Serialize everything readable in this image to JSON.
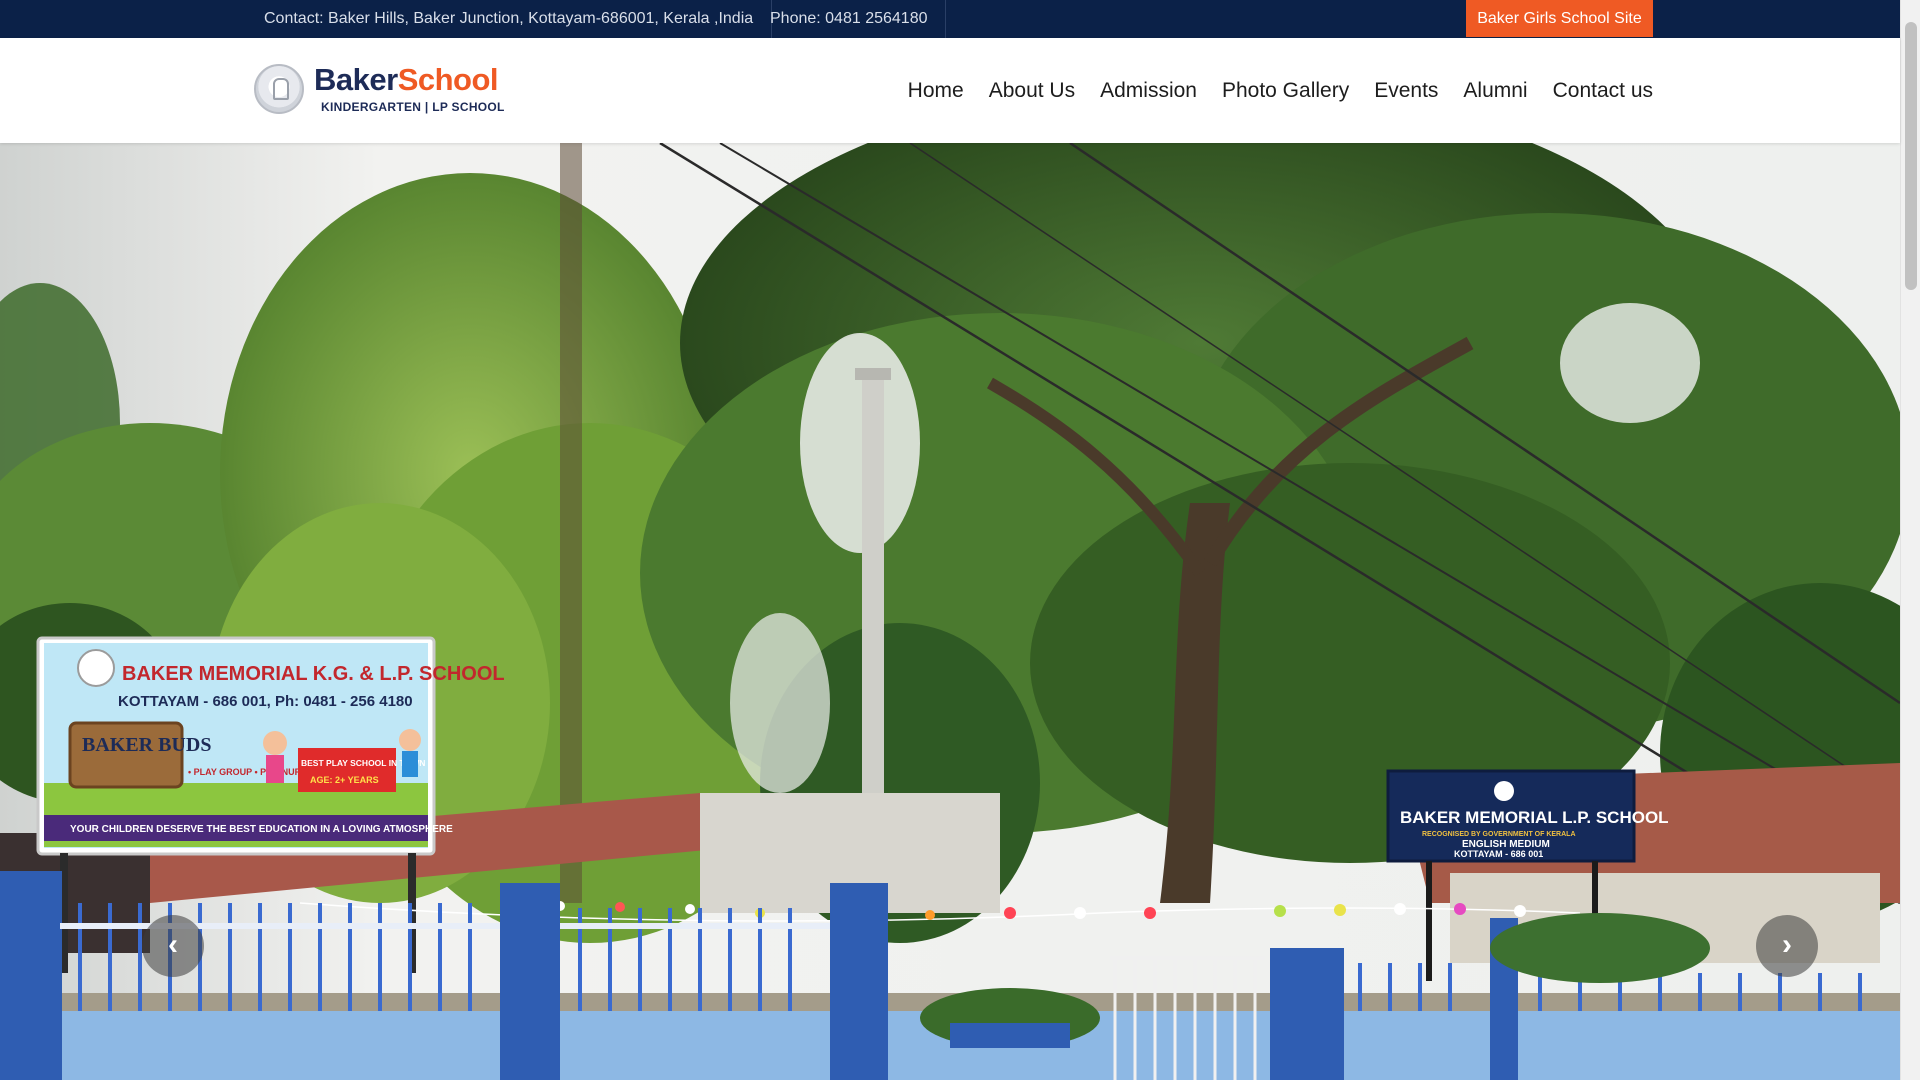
{
  "topbar": {
    "contact": "Contact: Baker Hills, Baker Junction, Kottayam-686001, Kerala ,India",
    "phone": "Phone: 0481 2564180",
    "girls_site_button": "Baker Girls School Site"
  },
  "logo": {
    "brand_part1": "Baker",
    "brand_part2": "School",
    "tagline": "KINDERGARTEN | LP SCHOOL"
  },
  "nav": {
    "items": [
      {
        "label": "Home"
      },
      {
        "label": "About Us"
      },
      {
        "label": "Admission"
      },
      {
        "label": "Photo Gallery"
      },
      {
        "label": "Events"
      },
      {
        "label": "Alumni"
      },
      {
        "label": "Contact us"
      }
    ]
  },
  "hero": {
    "board_left": {
      "title": "BAKER MEMORIAL K.G. & L.P. SCHOOL",
      "subtitle": "KOTTAYAM - 686 001, Ph: 0481 - 256 4180",
      "buds": "BAKER BUDS",
      "list": "• PLAY GROUP • PRE-NURSERY • DAY CARE",
      "badge": "BEST PLAY SCHOOL IN TOWN",
      "age": "AGE: 2+ YEARS",
      "footer": "YOUR CHILDREN DESERVE THE BEST EDUCATION IN A LOVING ATMOSPHERE"
    },
    "board_right": {
      "title": "BAKER MEMORIAL L.P. SCHOOL",
      "line1": "RECOGNISED BY GOVERNMENT OF KERALA",
      "line2": "ENGLISH MEDIUM",
      "line3": "KOTTAYAM - 686 001"
    },
    "prev_icon": "chevron-left-icon",
    "next_icon": "chevron-right-icon"
  },
  "colors": {
    "topbar_bg": "#0b2148",
    "accent": "#ef5a24",
    "brand_navy": "#1d2b57"
  }
}
